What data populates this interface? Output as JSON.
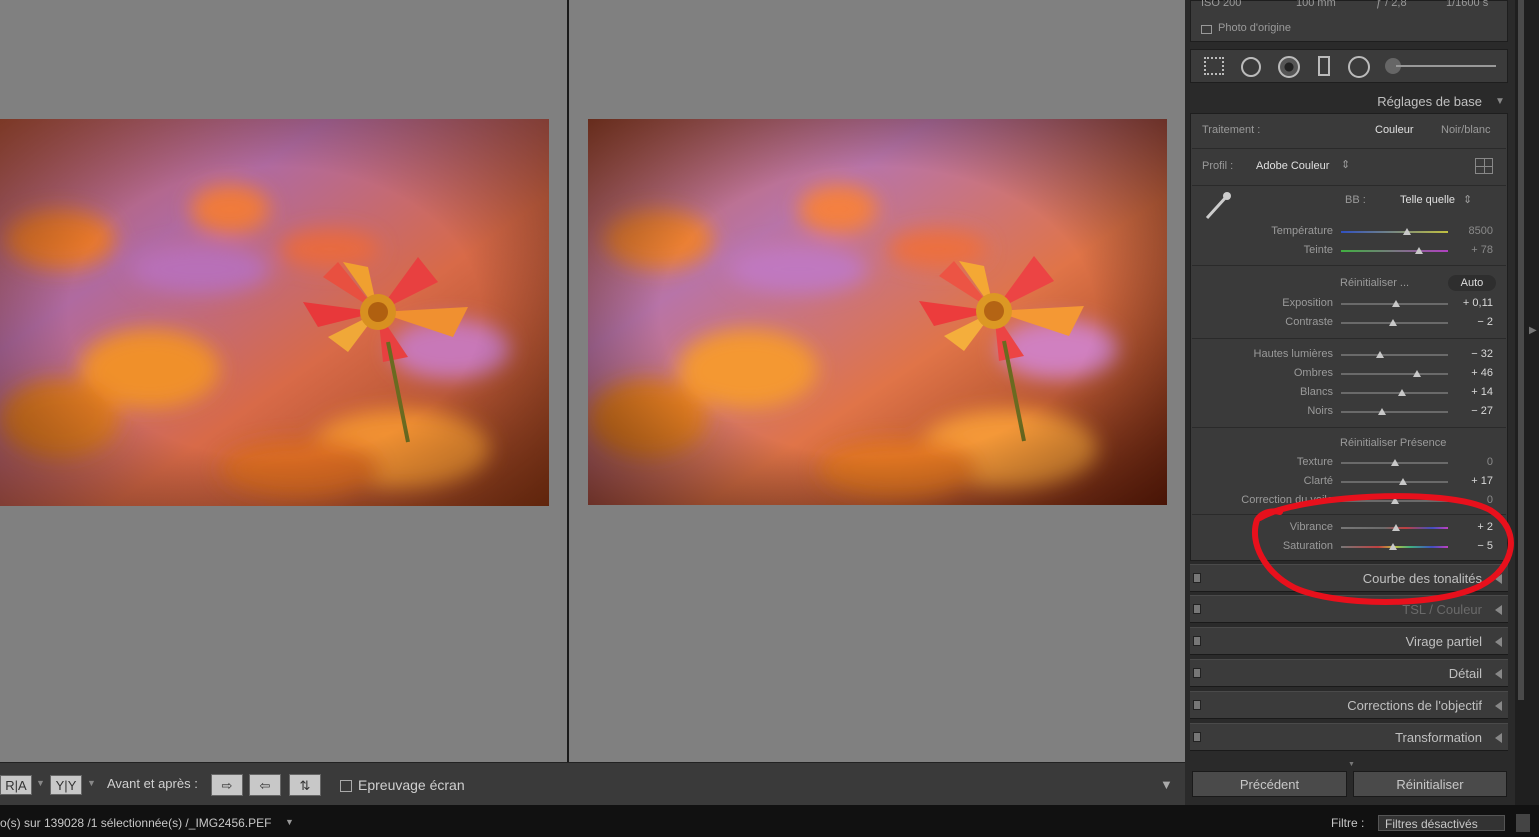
{
  "panel": {
    "exif": {
      "iso": "ISO 200",
      "focal": "100 mm",
      "aperture": "ƒ / 2,8",
      "shutter": "1/1600 s"
    },
    "original_photo_label": "Photo d'origine",
    "basic_header": "Réglages de base",
    "treatment": {
      "label": "Traitement :",
      "color": "Couleur",
      "bw": "Noir/blanc"
    },
    "profile": {
      "label": "Profil :",
      "value": "Adobe Couleur"
    },
    "wb": {
      "label": "BB :",
      "value": "Telle quelle"
    },
    "sliders": {
      "temperature": {
        "label": "Température",
        "value": "8500"
      },
      "tint": {
        "label": "Teinte",
        "value": "+ 78"
      },
      "exposure": {
        "label": "Exposition",
        "value": "+ 0,11"
      },
      "contrast": {
        "label": "Contraste",
        "value": "− 2"
      },
      "highlights": {
        "label": "Hautes lumières",
        "value": "− 32"
      },
      "shadows": {
        "label": "Ombres",
        "value": "+ 46"
      },
      "whites": {
        "label": "Blancs",
        "value": "+ 14"
      },
      "blacks": {
        "label": "Noirs",
        "value": "− 27"
      },
      "texture": {
        "label": "Texture",
        "value": "0"
      },
      "clarity": {
        "label": "Clarté",
        "value": "+ 17"
      },
      "dehaze": {
        "label": "Correction du voile",
        "value": "0"
      },
      "vibrance": {
        "label": "Vibrance",
        "value": "+ 2"
      },
      "saturation": {
        "label": "Saturation",
        "value": "− 5"
      }
    },
    "tone_reset": "Réinitialiser ...",
    "auto": "Auto",
    "presence_reset": "Réinitialiser Présence",
    "sections": [
      "Courbe des tonalités",
      "TSL / Couleur",
      "Virage partiel",
      "Détail",
      "Corrections de l'objectif",
      "Transformation"
    ],
    "prev_button": "Précédent",
    "reset_button": "Réinitialiser"
  },
  "toolbar": {
    "view_ra": "R|A",
    "view_yy": "Y|Y",
    "before_after_label": "Avant et après :",
    "soft_proof_label": "Epreuvage écran"
  },
  "status": {
    "path": "o(s) sur 139028 /1 sélectionnée(s) /_IMG2456.PEF",
    "filter_label": "Filtre :",
    "filter_value": "Filtres désactivés"
  },
  "colors": {
    "annotation": "#e8101c",
    "viewer_bg": "#808080",
    "panel_bg": "#2a2a2a"
  }
}
